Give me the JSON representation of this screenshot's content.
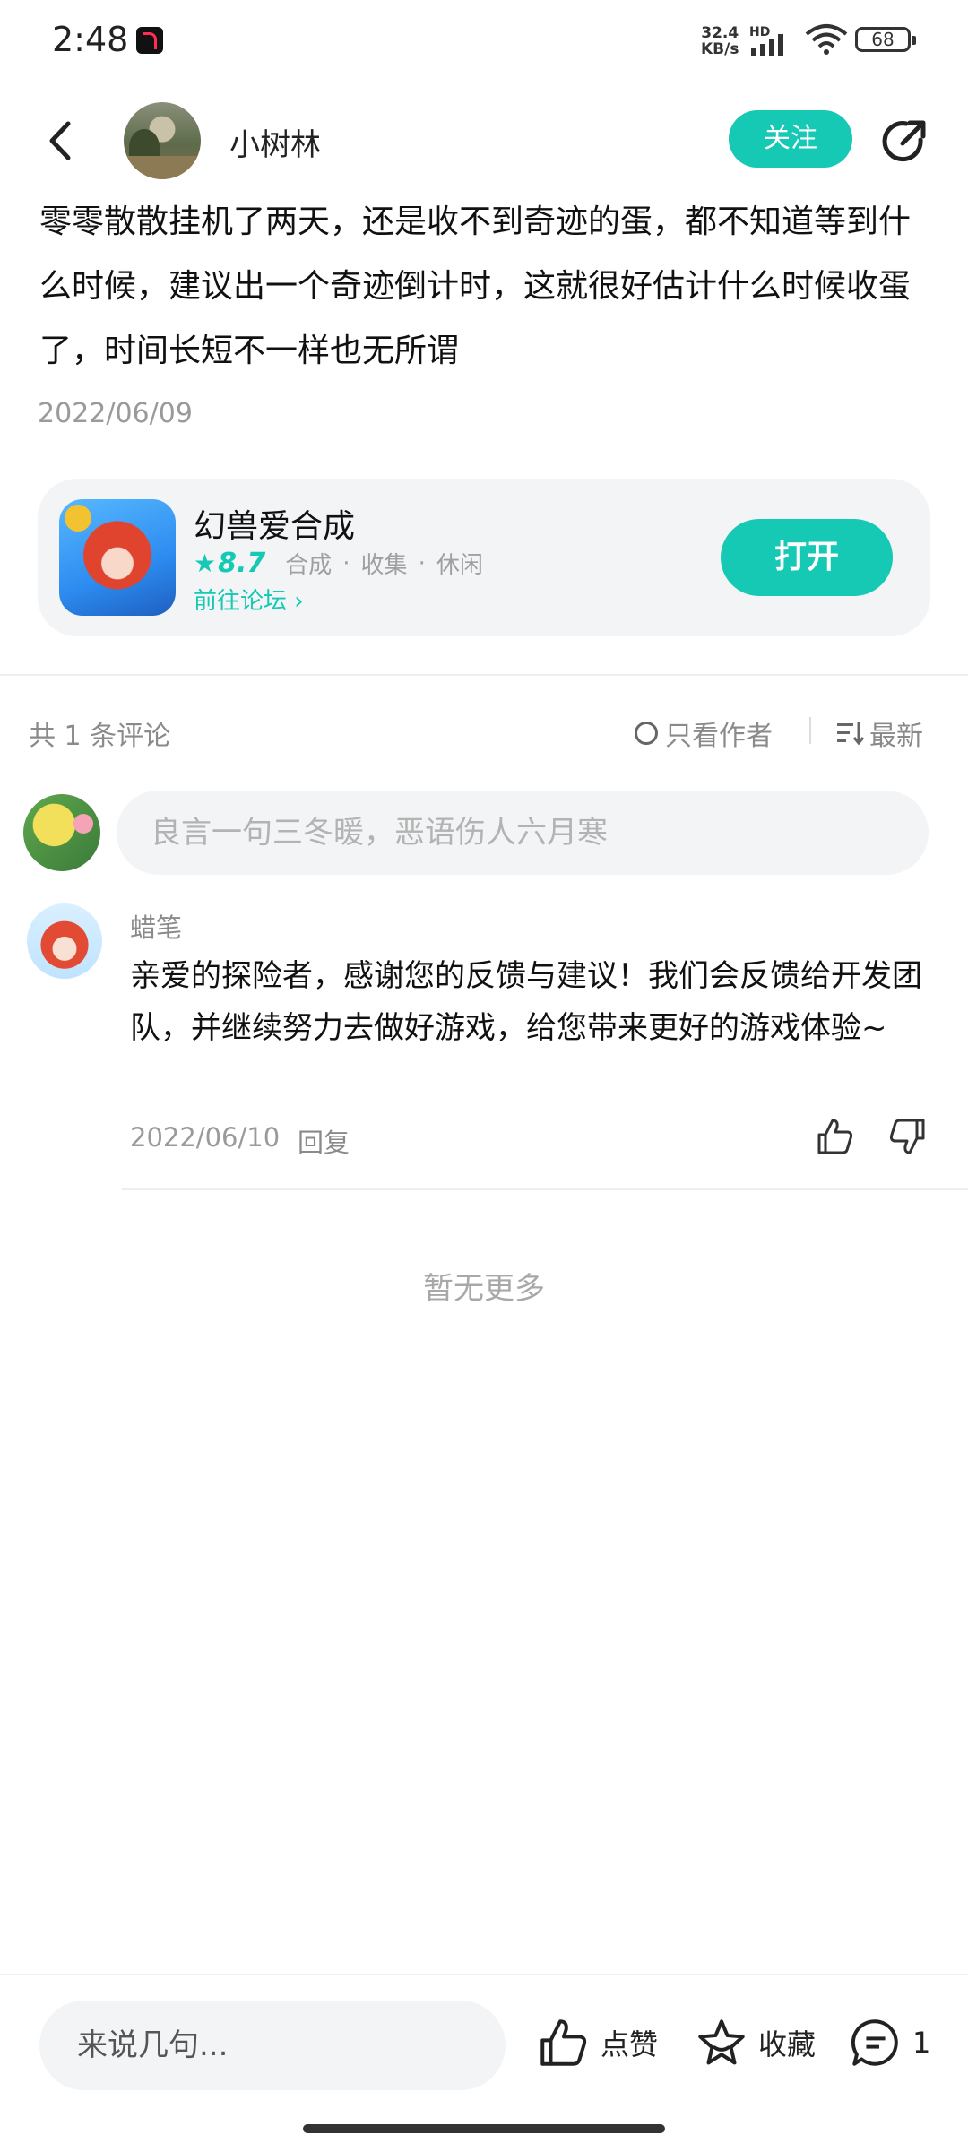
{
  "status_bar": {
    "time": "2:48",
    "net_speed_value": "32.4",
    "net_speed_unit": "KB/s",
    "hd_label": "HD",
    "battery": "68"
  },
  "header": {
    "author_name": "小树林",
    "follow_label": "关注"
  },
  "post": {
    "text": "零零散散挂机了两天，还是收不到奇迹的蛋，都不知道等到什么时候，建议出一个奇迹倒计时，这就很好估计什么时候收蛋了，时间长短不一样也无所谓",
    "date": "2022/06/09"
  },
  "app_card": {
    "name": "幻兽爱合成",
    "rating": "8.7",
    "tags": [
      "合成",
      "收集",
      "休闲"
    ],
    "forum_link": "前往论坛",
    "open_label": "打开"
  },
  "comments_header": {
    "count_label": "共 1 条评论",
    "only_author_label": "只看作者",
    "sort_label": "最新"
  },
  "comment_input": {
    "placeholder": "良言一句三冬暖，恶语伤人六月寒"
  },
  "comments": [
    {
      "author": "蜡笔",
      "text": "亲爱的探险者，感谢您的反馈与建议！我们会反馈给开发团队，并继续努力去做好游戏，给您带来更好的游戏体验~",
      "date": "2022/06/10",
      "reply_label": "回复"
    }
  ],
  "no_more_label": "暂无更多",
  "bottom_bar": {
    "input_placeholder": "来说几句...",
    "like_label": "点赞",
    "favorite_label": "收藏",
    "comment_count": "1"
  },
  "colors": {
    "accent": "#15c9b4",
    "muted_text": "#9a9a9a",
    "card_bg": "#f2f4f6"
  }
}
